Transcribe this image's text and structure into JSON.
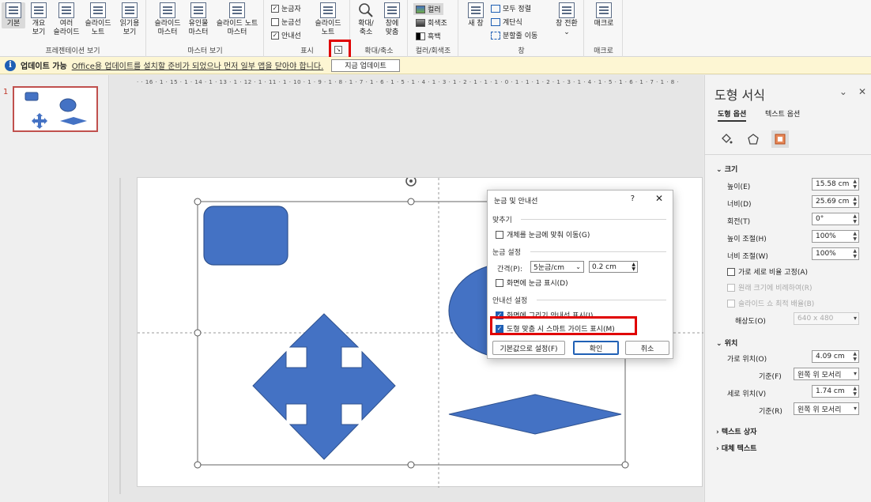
{
  "ribbon": {
    "groups": {
      "presentation_views": "프레젠테이션 보기",
      "master_views": "마스터 보기",
      "show": "표시",
      "zoom": "확대/축소",
      "color": "컬러/회색조",
      "window": "창",
      "macros": "매크로"
    },
    "buttons": {
      "normal": [
        "기본",
        ""
      ],
      "outline": [
        "개요",
        "보기"
      ],
      "sorter": [
        "여러",
        "슬라이드"
      ],
      "notes": [
        "슬라이드",
        "노트"
      ],
      "reading": [
        "읽기용",
        "보기"
      ],
      "slide_master": [
        "슬라이드",
        "마스터"
      ],
      "handout_master": [
        "유인물",
        "마스터"
      ],
      "notes_master": [
        "슬라이드 노트",
        "마스터"
      ],
      "notes_show": [
        "슬라이드",
        "노트"
      ],
      "zoom": [
        "확대/",
        "축소"
      ],
      "fit": [
        "창에",
        "맞춤"
      ],
      "new_window": [
        "새 창",
        ""
      ],
      "switch_window": [
        "창 전환",
        "⌄"
      ],
      "macros": [
        "매크로",
        ""
      ]
    },
    "show_checks": [
      {
        "label": "눈금자",
        "checked": true
      },
      {
        "label": "눈금선",
        "checked": false
      },
      {
        "label": "안내선",
        "checked": true
      }
    ],
    "color_options": [
      "컬러",
      "회색조",
      "흑백"
    ],
    "window_options": [
      "모두 정렬",
      "계단식",
      "분할줄 이동"
    ]
  },
  "message_bar": {
    "title": "업데이트 가능",
    "text": "Office용 업데이트를 설치할 준비가 되었으나 먼저 일부 앱을 닫아야 합니다.",
    "button": "지금 업데이트"
  },
  "thumbnails": {
    "slide_number": "1"
  },
  "ruler": {
    "horizontal": "· · 16 · 1 · 15 · 1 · 14 · 1 · 13 · 1 · 12 · 1 · 11 · 1 · 10 · 1 · 9 · 1 · 8 · 1 · 7 · 1 · 6 · 1 · 5 · 1 · 4 · 1 · 3 · 1 · 2 · 1 · 1 · 1 · 0 · 1 · 1 · 1 · 2 · 1 · 3 · 1 · 4 · 1 · 5 · 1 · 6 · 1 · 7 · 1 · 8 · 1 · 9 · 1 · 10 · 1 · 11 · 1 · 12 · 1 · 13 · 1 · 14 · 1 · 15 · 1 · 16 · ·"
  },
  "format_pane": {
    "title": "도형 서식",
    "tabs": [
      "도형 옵션",
      "텍스트 옵션"
    ],
    "size_section": "크기",
    "height_label": "높이(E)",
    "height_value": "15.58 cm",
    "width_label": "너비(D)",
    "width_value": "25.69 cm",
    "rotation_label": "회전(T)",
    "rotation_value": "0°",
    "scale_h_label": "높이 조절(H)",
    "scale_h_value": "100%",
    "scale_w_label": "너비 조절(W)",
    "scale_w_value": "100%",
    "lock_aspect": "가로 세로 비율 고정(A)",
    "relative_original": "원래 크기에 비례하여(R)",
    "best_scale": "슬라이드 쇼 최적 배율(B)",
    "resolution_label": "해상도(O)",
    "resolution_value": "640 x 480",
    "position_section": "위치",
    "hpos_label": "가로 위치(O)",
    "hpos_value": "4.09 cm",
    "from_label_1": "기준(F)",
    "from_value_1": "왼쪽 위 모서리",
    "vpos_label": "세로 위치(V)",
    "vpos_value": "1.74 cm",
    "from_label_2": "기준(R)",
    "from_value_2": "왼쪽 위 모서리",
    "text_box_section": "텍스트 상자",
    "alt_text_section": "대체 텍스트"
  },
  "dialog": {
    "title": "눈금 및 안내선",
    "help": "?",
    "close": "✕",
    "snap_section": "맞추기",
    "snap_objects": "개체를 눈금에 맞춰 이동(G)",
    "grid_section": "눈금 설정",
    "spacing_label": "간격(P):",
    "spacing_value": "5눈금/cm",
    "spacing_cm": "0.2 cm",
    "show_grid": "화면에 눈금 표시(D)",
    "guides_section": "안내선 설정",
    "show_drawing_guides": "화면에 그리기 안내선 표시(I)",
    "smart_guides": "도형 맞춤 시 스마트 가이드 표시(M)",
    "default_button": "기본값으로 설정(F)",
    "ok_button": "확인",
    "cancel_button": "취소"
  },
  "colors": {
    "shape_fill": "#4472c4",
    "shape_stroke": "#2f528f",
    "highlight": "#e00000",
    "accent": "#1f5fb4"
  }
}
